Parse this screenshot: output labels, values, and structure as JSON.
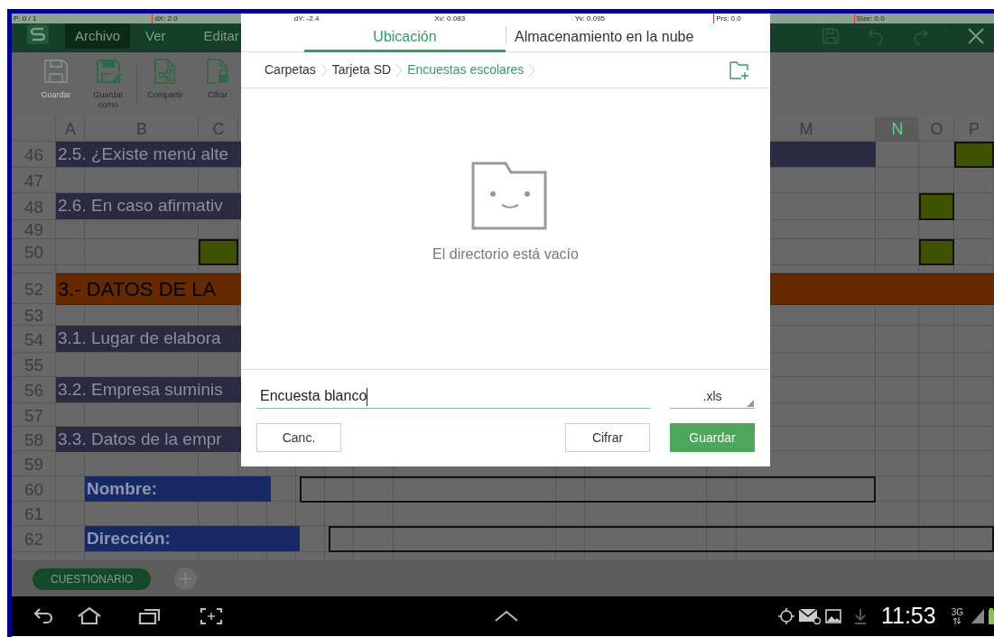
{
  "debug_bar": [
    "P: 0 / 1",
    "dX: 2.0",
    "dY: -2.4",
    "Xv: 0.083",
    "Yv: 0.095",
    "Prs: 0.0",
    "Size: 0.0"
  ],
  "app_bar": {
    "menus": [
      {
        "label": "Archivo",
        "selected": true
      },
      {
        "label": "Ver",
        "selected": false
      },
      {
        "label": "Editar",
        "selected": false
      }
    ]
  },
  "toolbar": [
    {
      "kind": "save",
      "label": "Guardar",
      "disabled": true
    },
    {
      "kind": "save_as",
      "label": "Guardar como",
      "disabled": false
    },
    {
      "kind": "share",
      "label": "Compartir",
      "disabled": false
    },
    {
      "kind": "encrypt",
      "label": "Cifrar",
      "disabled": false
    }
  ],
  "sheet": {
    "columns": [
      {
        "label": "A",
        "selected": false
      },
      {
        "label": "B",
        "selected": false
      },
      {
        "label": "C",
        "selected": false
      },
      {
        "label": "M",
        "selected": false
      },
      {
        "label": "N",
        "selected": true
      },
      {
        "label": "O",
        "selected": false
      },
      {
        "label": "P",
        "selected": false
      }
    ],
    "rows": [
      {
        "number": "46",
        "kind": "section",
        "text": "2.5. ¿Existe menú alte"
      },
      {
        "number": "47",
        "kind": "blank"
      },
      {
        "number": "48",
        "kind": "section",
        "text": "2.6. En caso afirmativ"
      },
      {
        "number": "49",
        "kind": "blank"
      },
      {
        "number": "50",
        "kind": "blank"
      },
      {
        "kind": "blank"
      },
      {
        "number": "52",
        "kind": "heading",
        "text": "3.- DATOS DE LA"
      },
      {
        "number": "53",
        "kind": "blank"
      },
      {
        "number": "54",
        "kind": "section",
        "text": "3.1. Lugar de elabora"
      },
      {
        "number": "55",
        "kind": "blank"
      },
      {
        "number": "56",
        "kind": "section",
        "text": "3.2. Empresa suminis"
      },
      {
        "number": "57",
        "kind": "blank"
      },
      {
        "number": "58",
        "kind": "section",
        "text": "3.3. Datos de la empr"
      },
      {
        "number": "59",
        "kind": "blank"
      },
      {
        "number": "60",
        "kind": "field",
        "text": "Nombre:"
      },
      {
        "number": "61",
        "kind": "blank"
      },
      {
        "number": "62",
        "kind": "field",
        "text": "Dirección:"
      },
      {
        "kind": "blank"
      }
    ]
  },
  "sheet_tabs": [
    {
      "label": "CUESTIONARIO",
      "selected": true
    }
  ],
  "dialog": {
    "tabs": [
      {
        "label": "Ubicación",
        "selected": true
      },
      {
        "label": "Almacenamiento en la nube",
        "selected": false
      }
    ],
    "breadcrumb": [
      {
        "label": "Carpetas",
        "selected": false
      },
      {
        "label": "Tarjeta SD",
        "selected": false
      },
      {
        "label": "Encuestas escolares",
        "selected": true
      }
    ],
    "empty_message": "El directorio está vacío",
    "filename": {
      "value": "Encuesta blanco"
    },
    "format": ".xls",
    "buttons": [
      {
        "kind": "outline",
        "label": "Canc."
      },
      {
        "kind": "outline",
        "label": "Cifrar"
      },
      {
        "kind": "primary",
        "label": "Guardar"
      }
    ]
  },
  "status_bar": {
    "time": "11:53",
    "network": "3G"
  }
}
